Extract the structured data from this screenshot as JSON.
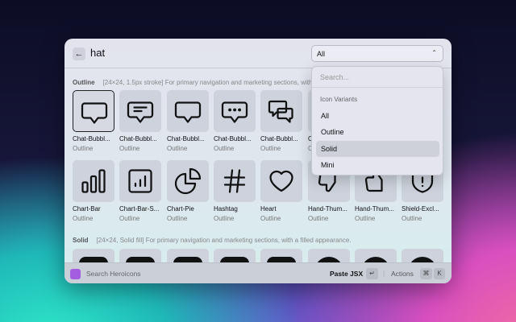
{
  "header": {
    "query": "hat",
    "filter_value": "All"
  },
  "dropdown": {
    "placeholder": "Search...",
    "group": "Icon Variants",
    "options": [
      "All",
      "Outline",
      "Solid",
      "Mini"
    ],
    "highlighted": "Solid"
  },
  "sections": {
    "outline": {
      "title": "Outline",
      "desc": "[24×24, 1.5px stroke] For primary navigation and marketing sections, with an outlined appearance."
    },
    "solid": {
      "title": "Solid",
      "desc": "[24×24, Solid fill] For primary navigation and marketing sections, with a filled appearance."
    }
  },
  "row1": [
    {
      "name": "Chat-Bubbl...",
      "variant": "Outline",
      "icon": "chat-bubble-oval-left-icon"
    },
    {
      "name": "Chat-Bubbl...",
      "variant": "Outline",
      "icon": "chat-bubble-bottom-center-text-icon"
    },
    {
      "name": "Chat-Bubbl...",
      "variant": "Outline",
      "icon": "chat-bubble-bottom-center-icon"
    },
    {
      "name": "Chat-Bubbl...",
      "variant": "Outline",
      "icon": "chat-bubble-ellipsis-icon"
    },
    {
      "name": "Chat-Bubbl...",
      "variant": "Outline",
      "icon": "chat-bubble-left-right-icon"
    },
    {
      "name": "Chat-Bubbl...",
      "variant": "Outline",
      "icon": "chat-bubble-icon"
    }
  ],
  "row2": [
    {
      "name": "Chart-Bar",
      "variant": "Outline",
      "icon": "chart-bar-icon"
    },
    {
      "name": "Chart-Bar-S...",
      "variant": "Outline",
      "icon": "chart-bar-square-icon"
    },
    {
      "name": "Chart-Pie",
      "variant": "Outline",
      "icon": "chart-pie-icon"
    },
    {
      "name": "Hashtag",
      "variant": "Outline",
      "icon": "hashtag-icon"
    },
    {
      "name": "Heart",
      "variant": "Outline",
      "icon": "heart-icon"
    },
    {
      "name": "Hand-Thum...",
      "variant": "Outline",
      "icon": "hand-thumb-down-icon"
    },
    {
      "name": "Hand-Thum...",
      "variant": "Outline",
      "icon": "hand-thumb-up-icon"
    },
    {
      "name": "Shield-Excl...",
      "variant": "Outline",
      "icon": "shield-exclamation-icon"
    }
  ],
  "footer": {
    "title": "Search Heroicons",
    "primary_action": "Paste JSX",
    "enter_key": "↵",
    "actions_label": "Actions",
    "cmd_key": "⌘",
    "k_key": "K"
  },
  "colors": {
    "accent": "#a45de0"
  }
}
